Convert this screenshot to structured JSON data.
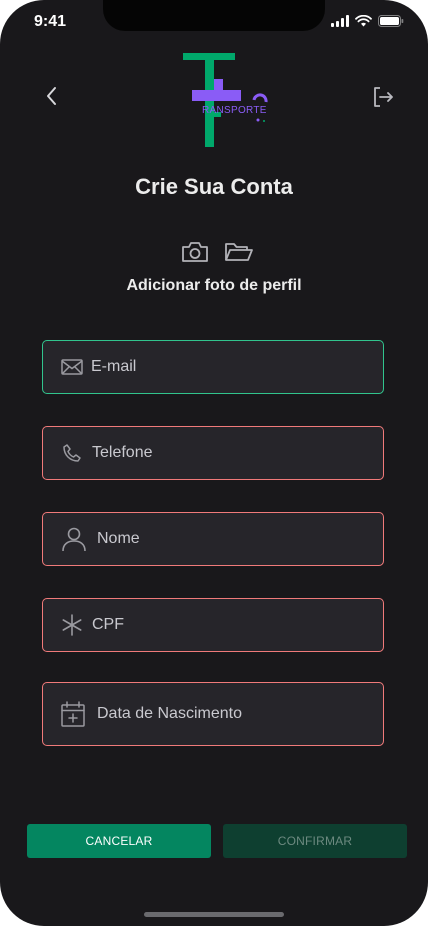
{
  "status": {
    "time": "9:41"
  },
  "logo": {
    "wordmark": "RANSPORTE",
    "primary_color": "#00a86b",
    "secondary_color": "#8a5cf6"
  },
  "header": {
    "title": "Crie Sua Conta"
  },
  "photo": {
    "label": "Adicionar foto de perfil"
  },
  "form": {
    "fields": [
      {
        "label": "E-mail",
        "icon": "mail-icon",
        "state": "valid"
      },
      {
        "label": "Telefone",
        "icon": "phone-icon",
        "state": "error"
      },
      {
        "label": "Nome",
        "icon": "user-icon",
        "state": "error"
      },
      {
        "label": "CPF",
        "icon": "asterisk-icon",
        "state": "error"
      },
      {
        "label": "Data de Nascimento",
        "icon": "calendar-icon",
        "state": "error"
      }
    ]
  },
  "actions": {
    "cancel": "CANCELAR",
    "confirm": "CONFIRMAR"
  },
  "colors": {
    "background": "#19181b",
    "field_background": "#26252a",
    "valid_border": "#31c48d",
    "error_border": "#f07a7a",
    "cancel_button": "#048660",
    "confirm_button_disabled": "#0e3f30"
  }
}
